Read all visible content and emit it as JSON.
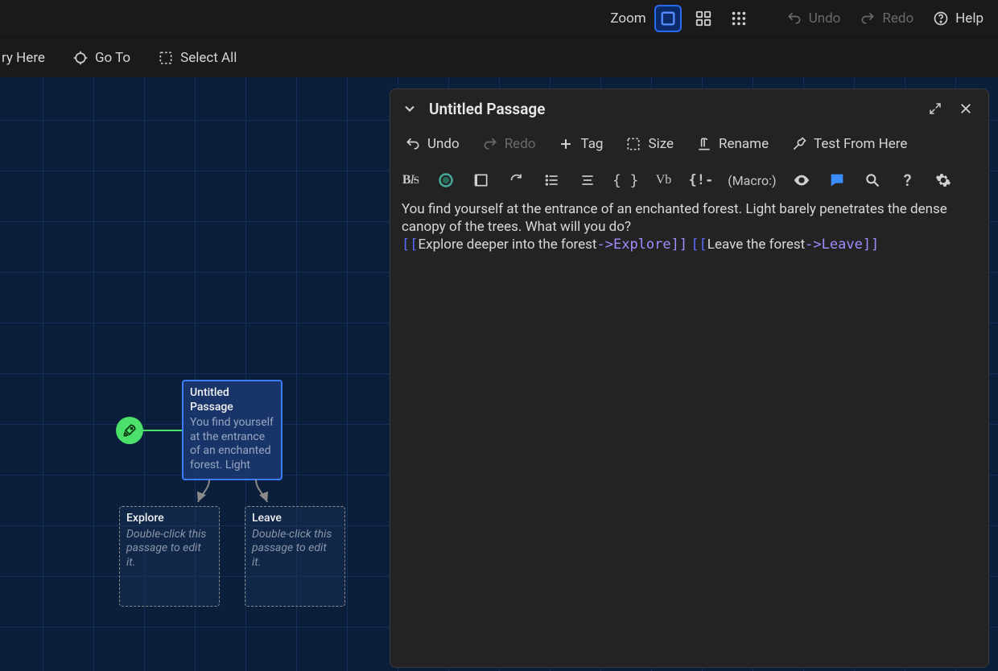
{
  "topbar": {
    "zoom_label": "Zoom",
    "undo_label": "Undo",
    "redo_label": "Redo",
    "help_label": "Help"
  },
  "secondbar": {
    "truncated_item": "ry Here",
    "goto_label": "Go To",
    "selectall_label": "Select All"
  },
  "canvas": {
    "start_passage": {
      "title": "Untitled Passage",
      "body": "You find yourself at the entrance of an enchanted forest. Light"
    },
    "child_a": {
      "title": "Explore",
      "body": "Double-click this passage to edit it."
    },
    "child_b": {
      "title": "Leave",
      "body": "Double-click this passage to edit it."
    }
  },
  "editor": {
    "title": "Untitled Passage",
    "actions": {
      "undo": "Undo",
      "redo": "Redo",
      "tag": "Tag",
      "size": "Size",
      "rename": "Rename",
      "test_from_here": "Test From Here"
    },
    "toolbar": {
      "macro_label": "(Macro:)"
    },
    "body": {
      "plain_1": "You find yourself at the entrance of an enchanted forest. Light barely penetrates the dense canopy of the trees. What will you do?",
      "link1_open": "[[",
      "link1_text": "Explore deeper into the forest",
      "link1_arrow": "->Explore]]",
      "space": " ",
      "link2_open": "[[",
      "link2_text": "Leave the forest",
      "link2_arrow": "->Leave]]"
    }
  }
}
